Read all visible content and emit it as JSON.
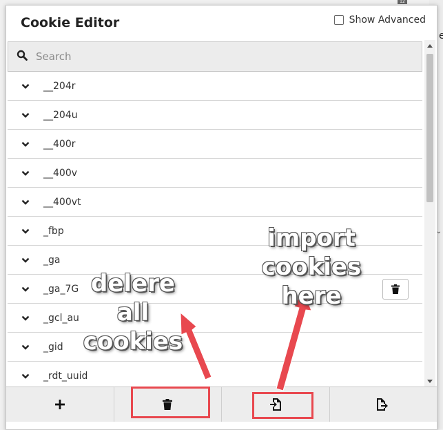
{
  "app": {
    "title": "Cookie Editor",
    "show_advanced_label": "Show Advanced",
    "show_advanced_checked": false
  },
  "search": {
    "placeholder": "Search"
  },
  "cookies": [
    {
      "name": "__204r"
    },
    {
      "name": "__204u"
    },
    {
      "name": "__400r"
    },
    {
      "name": "__400v"
    },
    {
      "name": "__400vt"
    },
    {
      "name": "_fbp"
    },
    {
      "name": "_ga"
    },
    {
      "name": "_ga_7G"
    },
    {
      "name": "_gcl_au"
    },
    {
      "name": "_gid"
    },
    {
      "name": "_rdt_uuid"
    }
  ],
  "footer": {
    "buttons": [
      {
        "icon": "plus-icon"
      },
      {
        "icon": "trash-icon"
      },
      {
        "icon": "import-icon"
      },
      {
        "icon": "export-icon"
      }
    ]
  },
  "annotations": {
    "delete_line1": "delere all",
    "delete_line2": "cookies",
    "import_line1": "import cookies",
    "import_line2": "here",
    "color": "#e8484f"
  },
  "background": {
    "badge_text": "12",
    "side_letter": "e"
  }
}
